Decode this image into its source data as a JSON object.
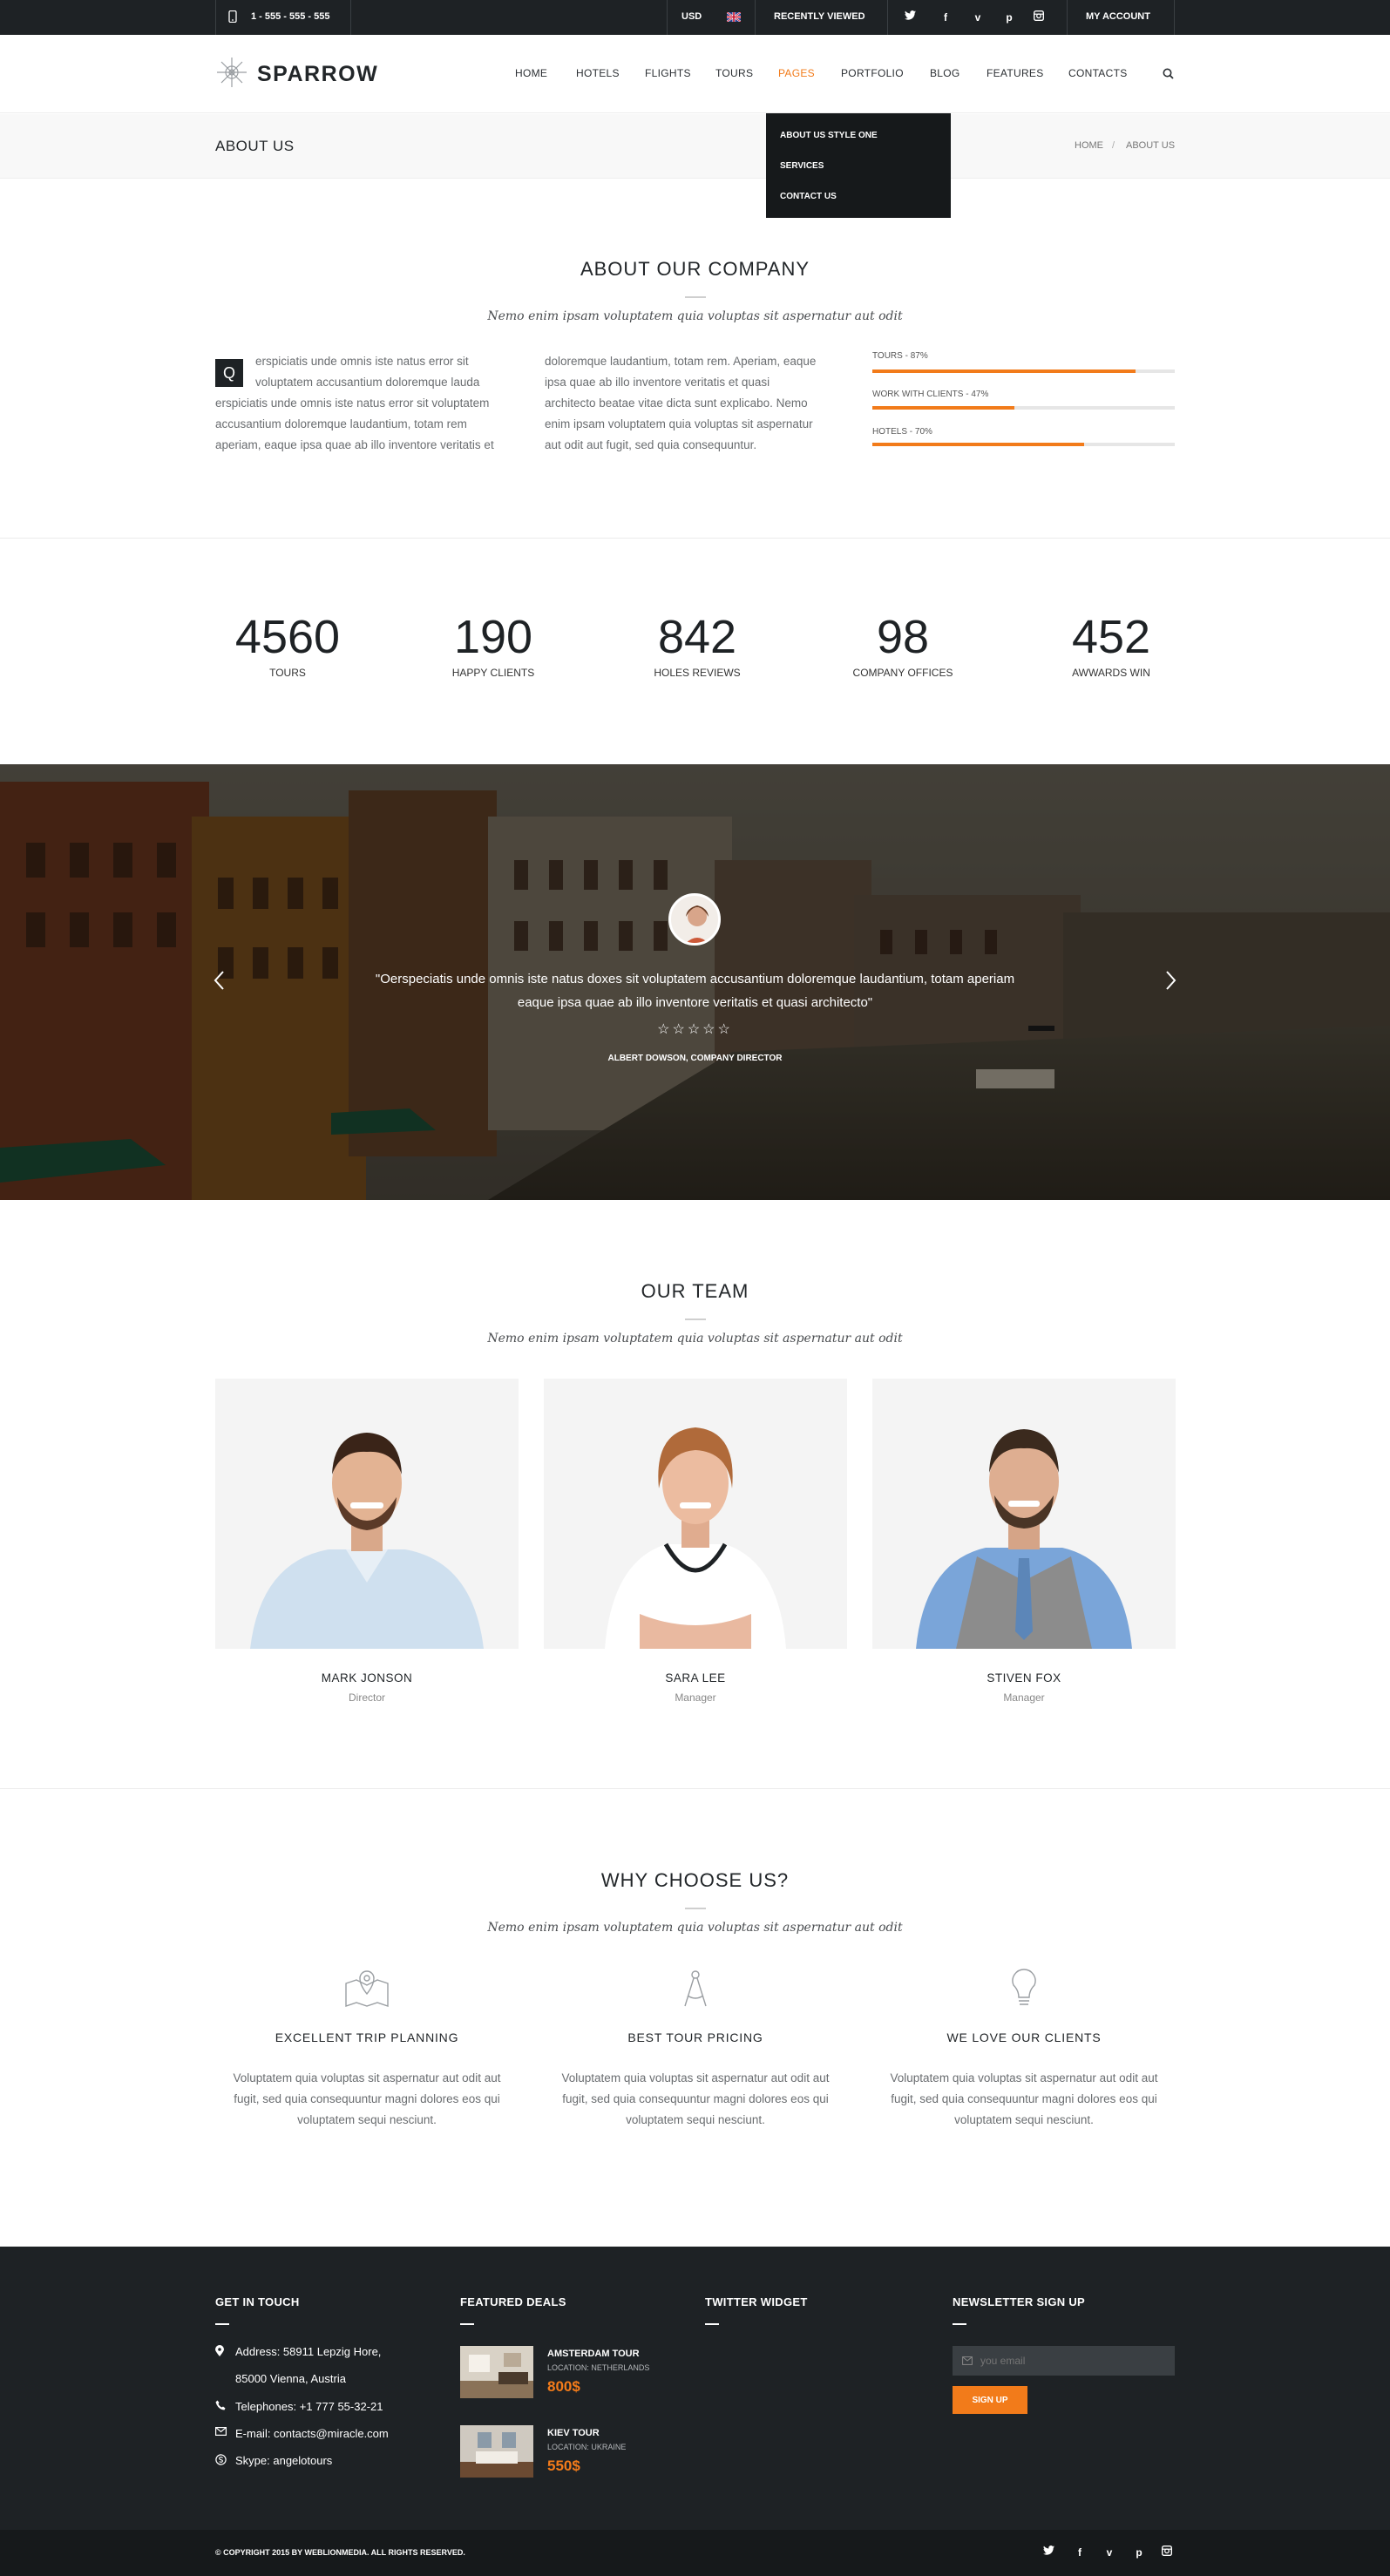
{
  "topbar": {
    "phone": "1 - 555 - 555 - 555",
    "currency": "USD",
    "recently_viewed": "RECENTLY VIEWED",
    "my_account": "MY ACCOUNT",
    "social_icons": [
      "twitter-icon",
      "facebook-icon",
      "vimeo-icon",
      "pinterest-icon",
      "instagram-icon"
    ]
  },
  "header": {
    "logo": "SPARROW",
    "nav": [
      "HOME",
      "HOTELS",
      "FLIGHTS",
      "TOURS",
      "PAGES",
      "PORTFOLIO",
      "BLOG",
      "FEATURES",
      "CONTACTS"
    ],
    "active_nav": "PAGES",
    "dropdown": [
      "ABOUT US STYLE ONE",
      "SERVICES",
      "CONTACT US"
    ]
  },
  "titlebar": {
    "title": "ABOUT US",
    "breadcrumb_home": "HOME",
    "breadcrumb_sep": "/",
    "breadcrumb_current": "ABOUT US"
  },
  "about": {
    "title": "ABOUT OUR COMPANY",
    "subtitle": "Nemo enim ipsam voluptatem quia voluptas sit aspernatur aut odit",
    "dropcap": "Q",
    "col1_lines": [
      "erspiciatis unde omnis iste natus error sit",
      "voluptatem accusantium doloremque lauda",
      "erspiciatis unde omnis iste natus error sit voluptatem",
      "accusantium doloremque laudantium, totam rem",
      "aperiam, eaque ipsa quae ab illo inventore veritatis et"
    ],
    "col2_lines": [
      "doloremque laudantium, totam rem. Aperiam, eaque",
      "ipsa quae ab illo inventore veritatis et quasi",
      "architecto beatae vitae dicta sunt explicabo. Nemo",
      "enim ipsam voluptatem quia voluptas sit aspernatur",
      "aut odit aut fugit, sed quia consequuntur."
    ],
    "bars": [
      {
        "label": "TOURS - 87%",
        "value": 87
      },
      {
        "label": "WORK WITH CLIENTS - 47%",
        "value": 47
      },
      {
        "label": "HOTELS - 70%",
        "value": 70
      }
    ]
  },
  "counters": [
    {
      "value": "4560",
      "label": "TOURS"
    },
    {
      "value": "190",
      "label": "HAPPY CLIENTS"
    },
    {
      "value": "842",
      "label": "HOLES REVIEWS"
    },
    {
      "value": "98",
      "label": "COMPANY OFFICES"
    },
    {
      "value": "452",
      "label": "AWWARDS WIN"
    }
  ],
  "testimonial": {
    "quote_line1": "\"Oerspeciatis unde omnis iste natus doxes sit voluptatem accusantium doloremque laudantium, totam aperiam",
    "quote_line2": "eaque ipsa quae ab illo inventore veritatis et quasi architecto\"",
    "stars": "☆☆☆☆☆",
    "author": "ALBERT DOWSON, COMPANY DIRECTOR"
  },
  "team": {
    "title": "OUR TEAM",
    "subtitle": "Nemo enim ipsam voluptatem quia voluptas sit aspernatur aut odit",
    "members": [
      {
        "name": "MARK JONSON",
        "role": "Director"
      },
      {
        "name": "SARA LEE",
        "role": "Manager"
      },
      {
        "name": "STIVEN FOX",
        "role": "Manager"
      }
    ]
  },
  "why": {
    "title": "WHY CHOOSE US?",
    "subtitle": "Nemo enim ipsam voluptatem quia voluptas sit aspernatur aut odit",
    "items": [
      {
        "title": "EXCELLENT TRIP PLANNING",
        "icon": "map-icon",
        "lines": [
          "Voluptatem quia voluptas sit aspernatur aut odit aut",
          "fugit, sed quia consequuntur magni dolores eos qui",
          "voluptatem sequi nesciunt."
        ]
      },
      {
        "title": "BEST TOUR PRICING",
        "icon": "compass-icon",
        "lines": [
          "Voluptatem quia voluptas sit aspernatur aut odit aut",
          "fugit, sed quia consequuntur magni dolores eos qui",
          "voluptatem sequi nesciunt."
        ]
      },
      {
        "title": "WE LOVE OUR CLIENTS",
        "icon": "lightbulb-icon",
        "lines": [
          "Voluptatem quia voluptas sit aspernatur aut odit aut",
          "fugit, sed quia consequuntur magni dolores eos qui",
          "voluptatem sequi nesciunt."
        ]
      }
    ]
  },
  "footer": {
    "get_in_touch": {
      "title": "GET IN TOUCH",
      "address1": "Address: 58911 Lepzig Hore,",
      "address2": "85000 Vienna, Austria",
      "phone": "Telephones: +1 777 55-32-21",
      "email": "E-mail: contacts@miracle.com",
      "skype": "Skype: angelotours"
    },
    "featured_deals": {
      "title": "FEATURED DEALS",
      "deals": [
        {
          "title": "AMSTERDAM TOUR",
          "location": "LOCATION: NETHERLANDS",
          "price": "800$"
        },
        {
          "title": "KIEV TOUR",
          "location": "LOCATION: UKRAINE",
          "price": "550$"
        }
      ]
    },
    "twitter": {
      "title": "TWITTER WIDGET"
    },
    "newsletter": {
      "title": "NEWSLETTER SIGN UP",
      "placeholder": "you email",
      "button": "SIGN UP"
    },
    "copyright": "© COPYRIGHT 2015 BY WEBLIONMEDIA. ALL RIGHTS RESERVED."
  },
  "colors": {
    "accent": "#f27b1a",
    "dark": "#1e2225"
  }
}
